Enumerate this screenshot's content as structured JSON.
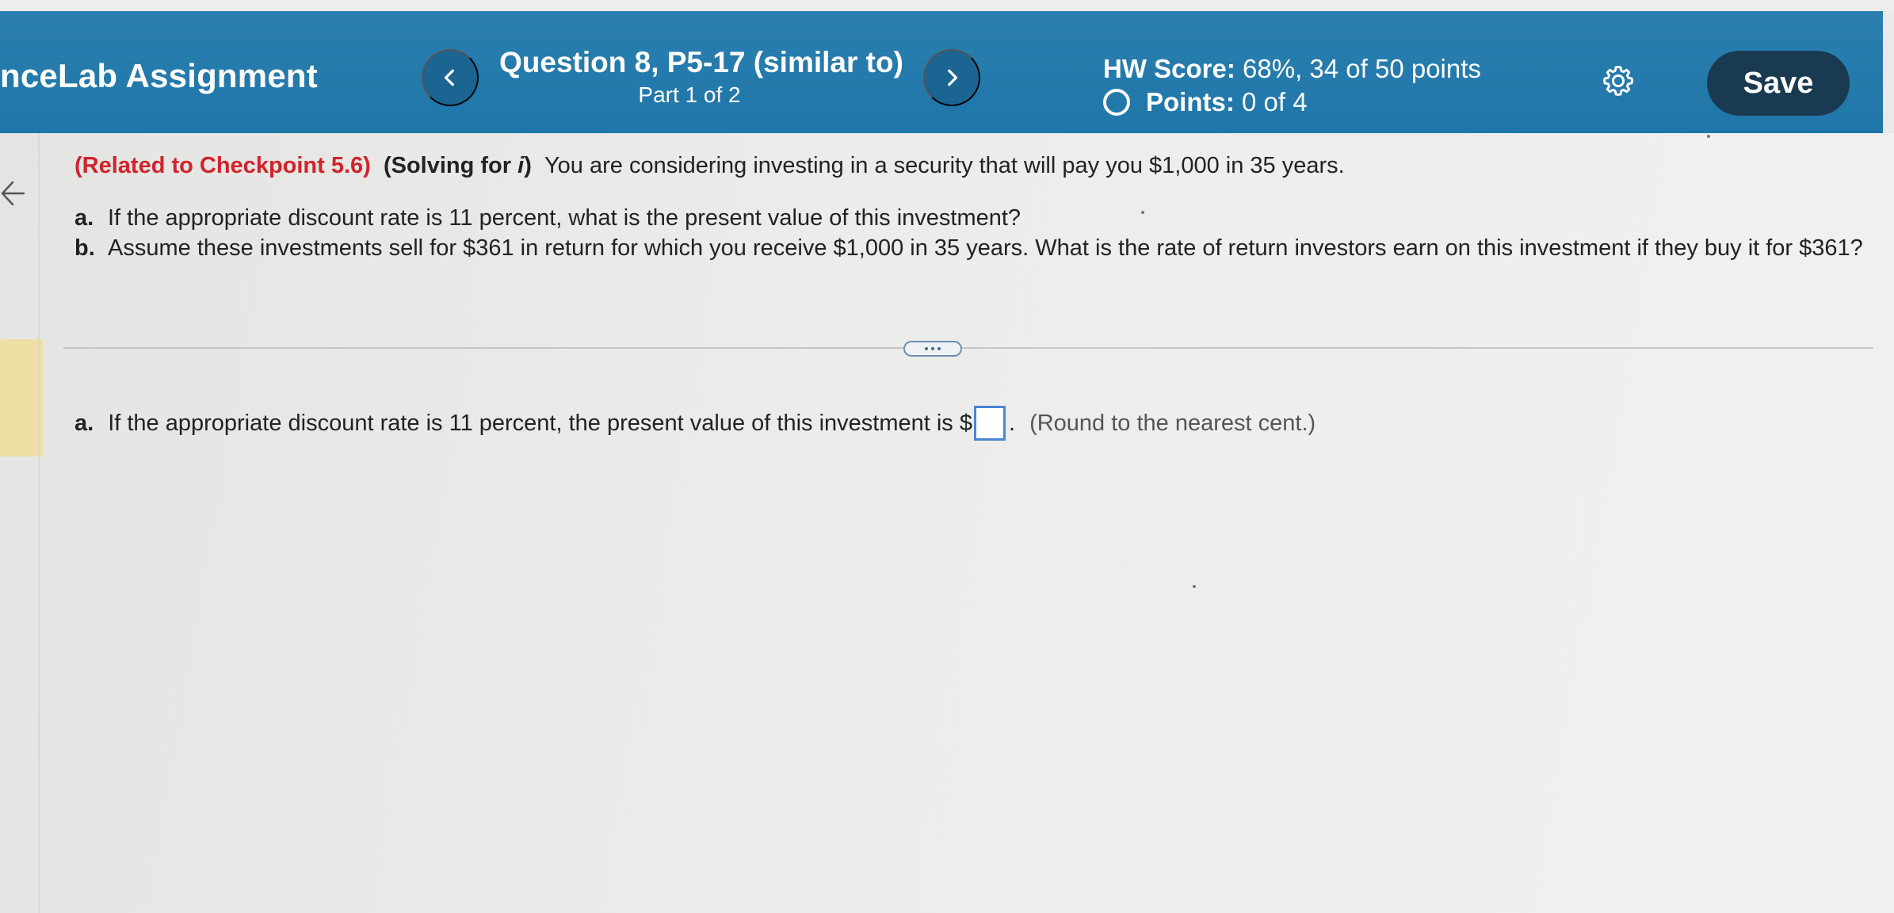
{
  "header": {
    "app_title": "nceLab Assignment",
    "question_title": "Question 8, P5-17 (similar to)",
    "question_part": "Part 1 of 2",
    "hw_score_label": "HW Score:",
    "hw_score_value": "68%, 34 of 50 points",
    "points_label": "Points:",
    "points_value": "0 of 4",
    "save_label": "Save"
  },
  "question": {
    "related": "(Related to Checkpoint 5.6)",
    "solving_prefix": "(Solving for ",
    "solving_var": "i",
    "solving_suffix": ")",
    "intro": "You are considering investing in a security that will pay you $1,000 in 35 years.",
    "parts": [
      {
        "label": "a.",
        "text": "If the appropriate discount rate is 11 percent, what is the present value of this investment?"
      },
      {
        "label": "b.",
        "text": "Assume these investments sell for $361 in return for which you receive $1,000 in 35 years. What is the rate of return investors earn on this investment if they buy it for $361?"
      }
    ]
  },
  "answer": {
    "label": "a.",
    "prompt": "If the appropriate discount rate is 11 percent, the present value of this investment is $",
    "input_value": "",
    "after_input": ".",
    "hint": "(Round to the nearest cent.)"
  },
  "icons": {
    "prev": "chevron-left-icon",
    "next": "chevron-right-icon",
    "settings": "gear-icon",
    "back": "arrow-left-icon",
    "more": "ellipsis-icon"
  },
  "colors": {
    "header_bg": "#2a7fb0",
    "save_bg": "#1a3a52",
    "related_red": "#d2232a",
    "input_border": "#4a86d4"
  }
}
